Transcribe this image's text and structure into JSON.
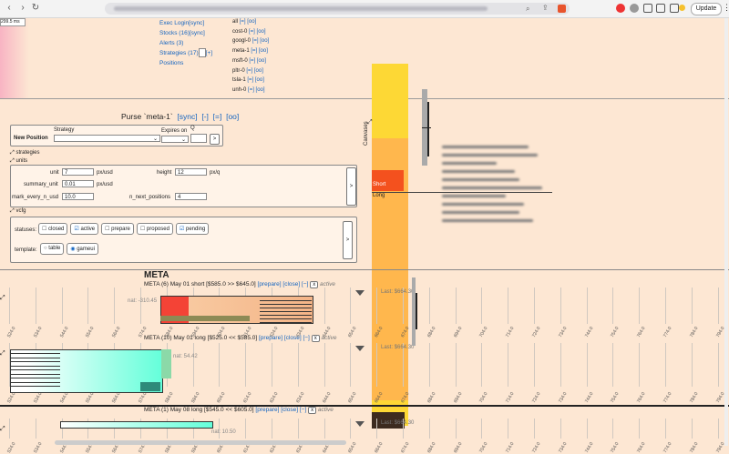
{
  "browser": {
    "update_label": "Update",
    "more_label": "⋮"
  },
  "fps": "299.5 ms",
  "menu": {
    "exec_login": "Exec Login[sync]",
    "stocks": "Stocks (16)[sync]",
    "alerts": "Alerts (3)",
    "strategies": "Strategies (17)",
    "strategies_plus": "[+]",
    "positions": "Positions"
  },
  "tickers": [
    {
      "name": "all",
      "links": "[=] [oo]"
    },
    {
      "name": "cost-0",
      "links": "[=] [oo]"
    },
    {
      "name": "googl-0",
      "links": "[=] [oo]"
    },
    {
      "name": "meta-1",
      "links": "[=] [oo]"
    },
    {
      "name": "msft-0",
      "links": "[=] [oo]"
    },
    {
      "name": "pltr-0",
      "links": "[=] [oo]"
    },
    {
      "name": "tsla-1",
      "links": "[=] [oo]"
    },
    {
      "name": "unh-0",
      "links": "[=] [oo]"
    }
  ],
  "purse": {
    "title": "Purse `meta-1`",
    "sync": "[sync]",
    "minus": "[-]",
    "eq": "[=]",
    "oo": "[oo]"
  },
  "new_position": {
    "label": "New Position",
    "strategy_label": "Strategy",
    "expires_label": "Expires on",
    "q_label": "Q",
    "go": ">"
  },
  "strategies_label": "strategies",
  "units": {
    "label": "units",
    "unit_label": "unit",
    "unit_value": "7",
    "unit_suffix": "px/usd",
    "height_label": "height",
    "height_value": "12",
    "height_suffix": "px/q",
    "summary_label": "summary_unit",
    "summary_value": "0.01",
    "summary_suffix": "px/usd",
    "mark_label": "mark_every_n_usd",
    "mark_value": "10.0",
    "nnext_label": "n_next_positions",
    "nnext_value": "4",
    "go": ">"
  },
  "vcfg": {
    "label": "vcfg",
    "statuses_label": "statuses:",
    "statuses": [
      {
        "label": "closed",
        "checked": false
      },
      {
        "label": "active",
        "checked": true
      },
      {
        "label": "prepare",
        "checked": false
      },
      {
        "label": "proposed",
        "checked": false
      },
      {
        "label": "pending",
        "checked": true
      }
    ],
    "template_label": "template:",
    "templates": [
      {
        "label": "table",
        "checked": false
      },
      {
        "label": "gameui",
        "checked": true
      }
    ],
    "go": ">"
  },
  "center": {
    "canvases_label": "Canvases",
    "short_label": "Short",
    "long_label": "Long",
    "last_label": "Last: $664.30"
  },
  "section_title": "META",
  "positions": [
    {
      "header": "META (6) May 01 short [$585.0 >> $645.0]",
      "actions": [
        "[prepare]",
        "[close]",
        "[−]",
        "x"
      ],
      "status": "active",
      "tag": "nat: -310.45"
    },
    {
      "header": "META (10) May 01 long [$525.0 << $585.0]",
      "actions": [
        "[prepare]",
        "[close]",
        "[−]",
        "x"
      ],
      "status": "active",
      "tag": "nat: 54.42"
    },
    {
      "header": "META (1) May 08 long [$545.0 << $605.0]",
      "actions": [
        "[prepare]",
        "[close]",
        "[−]",
        "x"
      ],
      "status": "active",
      "tag": "nat: 10.50"
    }
  ],
  "axis_ticks": [
    "524.0",
    "534.0",
    "544.0",
    "554.0",
    "564.0",
    "574.0",
    "584.0",
    "594.0",
    "604.0",
    "614.0",
    "624.0",
    "634.0",
    "644.0",
    "654.0",
    "664.0",
    "674.0",
    "684.0",
    "694.0",
    "704.0",
    "714.0",
    "724.0",
    "734.0",
    "744.0",
    "754.0",
    "764.0",
    "774.0",
    "784.0",
    "794.0",
    "804.0"
  ],
  "colors": {
    "short": "#f44336",
    "long": "#64ffda",
    "accent": "#1565c0",
    "gold": "#fdd835",
    "orange": "#ffb74d"
  }
}
